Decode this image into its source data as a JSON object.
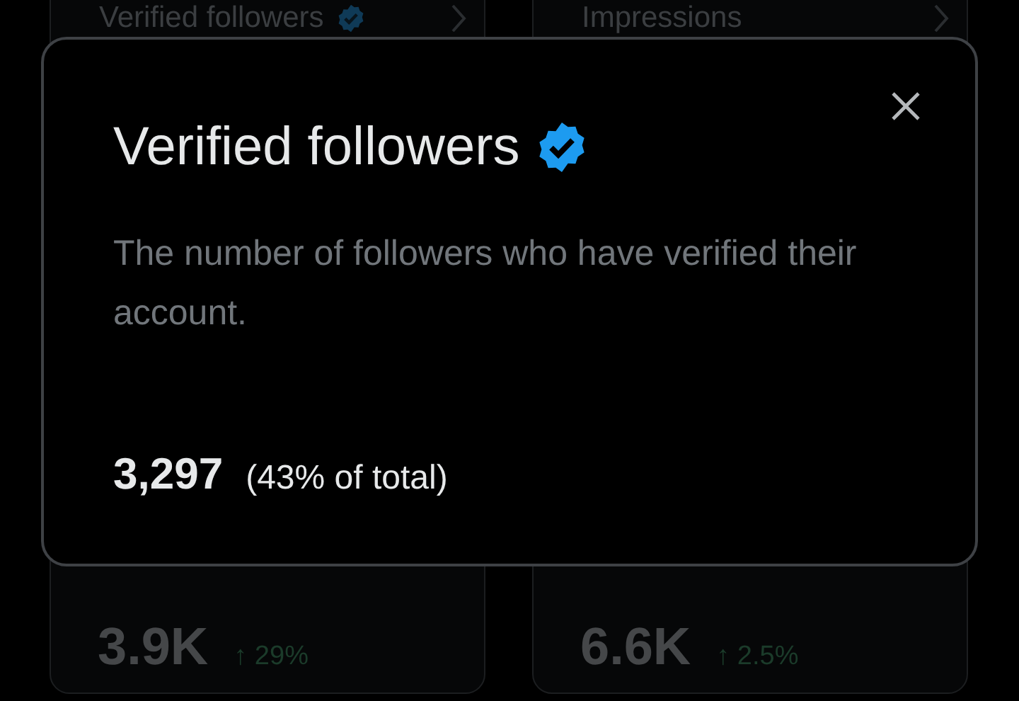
{
  "top_cards": [
    {
      "title": "Verified followers",
      "verified": true
    },
    {
      "title": "Impressions",
      "verified": false
    }
  ],
  "bottom_cards": [
    {
      "value": "3.9K",
      "change": "↑ 29%"
    },
    {
      "value": "6.6K",
      "change": "↑ 2.5%"
    }
  ],
  "dialog": {
    "title": "Verified followers",
    "verified": true,
    "description": "The number of followers who have verified their account.",
    "value": "3,297",
    "share": "(43% of total)"
  }
}
